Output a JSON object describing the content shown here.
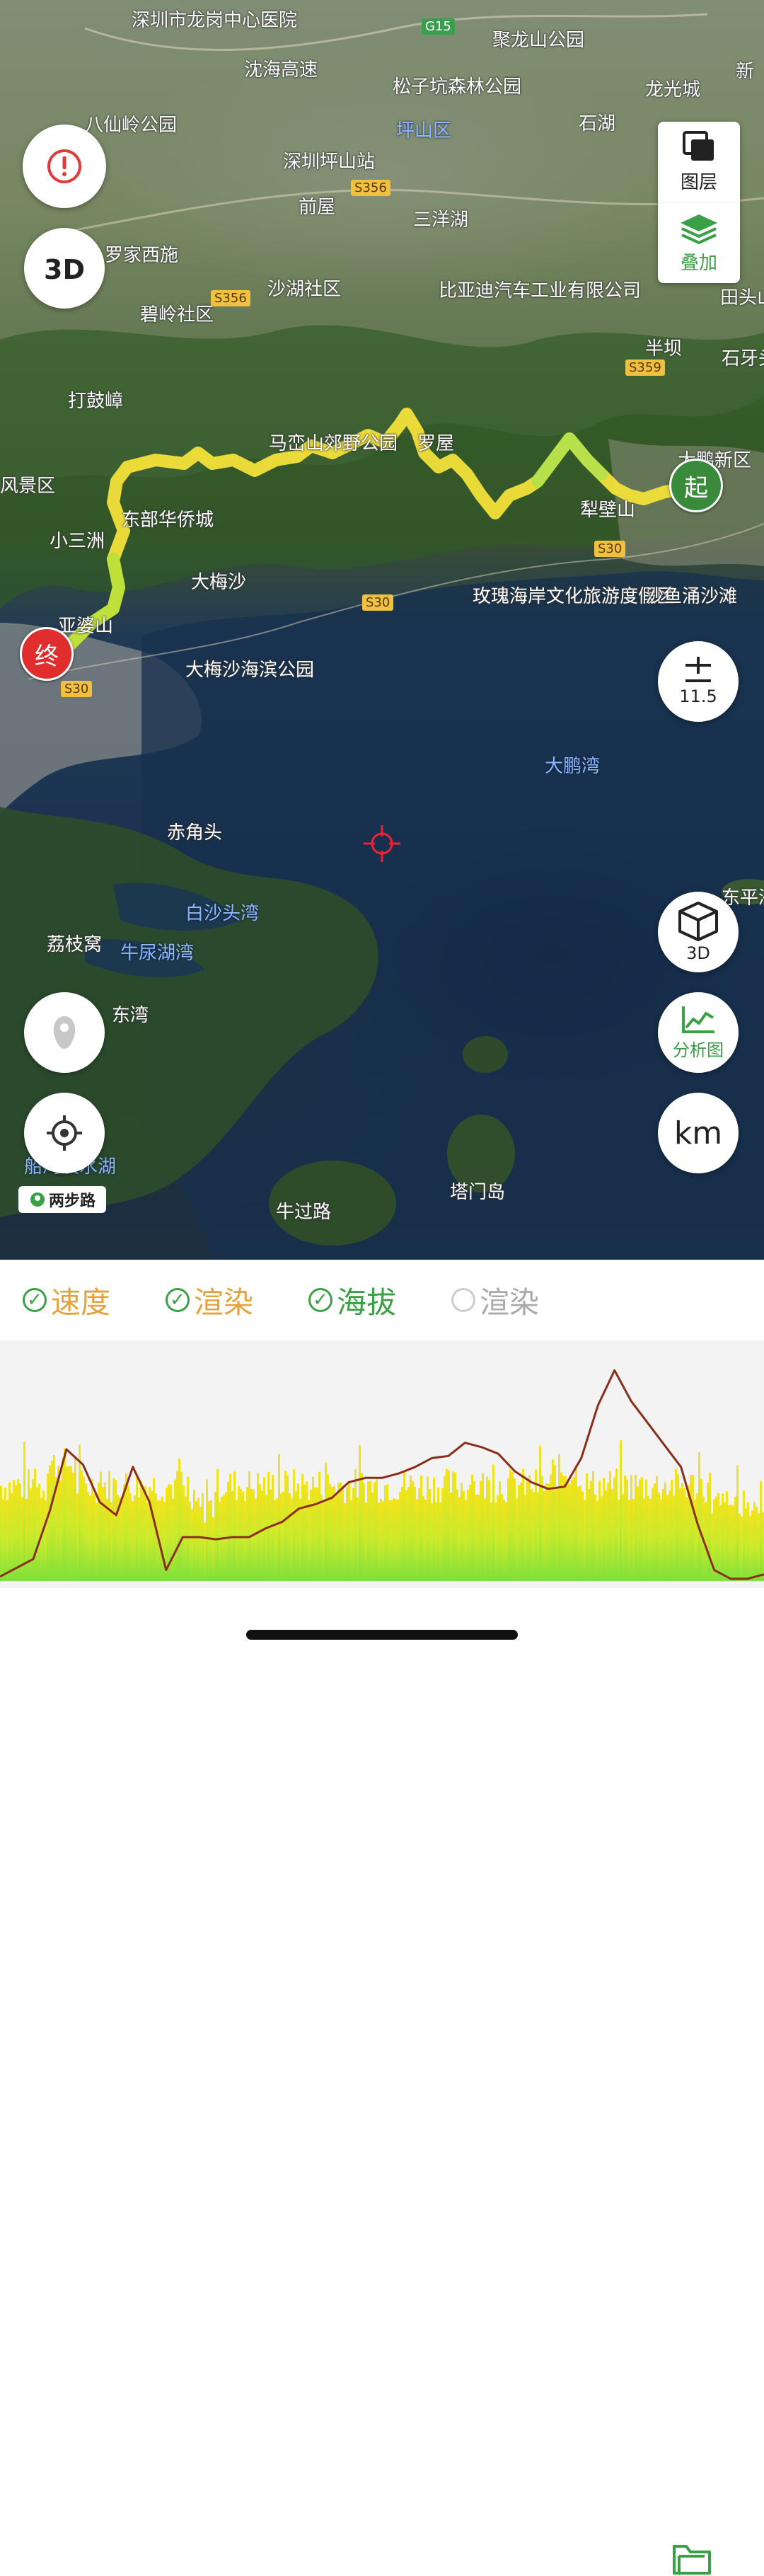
{
  "map": {
    "labels": [
      {
        "text": "深圳市龙岗中心医院",
        "x": 186,
        "y": 8,
        "cls": ""
      },
      {
        "text": "沈海高速",
        "x": 345,
        "y": 78,
        "cls": ""
      },
      {
        "text": "聚龙山公园",
        "x": 696,
        "y": 36,
        "cls": ""
      },
      {
        "text": "松子坑森林公园",
        "x": 555,
        "y": 102,
        "cls": ""
      },
      {
        "text": "龙光城",
        "x": 912,
        "y": 106,
        "cls": ""
      },
      {
        "text": "新",
        "x": 1040,
        "y": 80,
        "cls": ""
      },
      {
        "text": "八仙岭公园",
        "x": 120,
        "y": 156,
        "cls": ""
      },
      {
        "text": "坪山区",
        "x": 560,
        "y": 164,
        "cls": "water"
      },
      {
        "text": "石湖",
        "x": 818,
        "y": 154,
        "cls": ""
      },
      {
        "text": "深圳坪山站",
        "x": 400,
        "y": 208,
        "cls": ""
      },
      {
        "text": "前屋",
        "x": 422,
        "y": 272,
        "cls": ""
      },
      {
        "text": "三洋湖",
        "x": 584,
        "y": 290,
        "cls": ""
      },
      {
        "text": "罗家西施",
        "x": 148,
        "y": 340,
        "cls": ""
      },
      {
        "text": "沙湖社区",
        "x": 378,
        "y": 388,
        "cls": ""
      },
      {
        "text": "比亚迪汽车工业有限公司",
        "x": 620,
        "y": 390,
        "cls": ""
      },
      {
        "text": "碧岭社区",
        "x": 198,
        "y": 424,
        "cls": ""
      },
      {
        "text": "田头山",
        "x": 1018,
        "y": 400,
        "cls": ""
      },
      {
        "text": "半坝",
        "x": 912,
        "y": 472,
        "cls": ""
      },
      {
        "text": "石牙头",
        "x": 1020,
        "y": 486,
        "cls": ""
      },
      {
        "text": "打鼓嶂",
        "x": 96,
        "y": 546,
        "cls": ""
      },
      {
        "text": "马峦山郊野公园",
        "x": 380,
        "y": 606,
        "cls": ""
      },
      {
        "text": "罗屋",
        "x": 590,
        "y": 606,
        "cls": ""
      },
      {
        "text": "大鹏新区",
        "x": 958,
        "y": 630,
        "cls": ""
      },
      {
        "text": "风景区",
        "x": 0,
        "y": 666,
        "cls": ""
      },
      {
        "text": "东部华侨城",
        "x": 172,
        "y": 714,
        "cls": ""
      },
      {
        "text": "犁壁山",
        "x": 820,
        "y": 700,
        "cls": ""
      },
      {
        "text": "小三洲",
        "x": 70,
        "y": 744,
        "cls": ""
      },
      {
        "text": "大梅沙",
        "x": 270,
        "y": 802,
        "cls": ""
      },
      {
        "text": "玫瑰海岸文化旅游度假区",
        "x": 668,
        "y": 822,
        "cls": ""
      },
      {
        "text": "沙鱼涌沙滩",
        "x": 912,
        "y": 822,
        "cls": ""
      },
      {
        "text": "亚婆山",
        "x": 82,
        "y": 864,
        "cls": ""
      },
      {
        "text": "大梅沙海滨公园",
        "x": 262,
        "y": 926,
        "cls": ""
      },
      {
        "text": "大鹏湾",
        "x": 770,
        "y": 1062,
        "cls": "water"
      },
      {
        "text": "赤角头",
        "x": 236,
        "y": 1156,
        "cls": ""
      },
      {
        "text": "东平洲",
        "x": 1020,
        "y": 1248,
        "cls": ""
      },
      {
        "text": "白沙头湾",
        "x": 262,
        "y": 1270,
        "cls": "water"
      },
      {
        "text": "荔枝窝",
        "x": 66,
        "y": 1314,
        "cls": ""
      },
      {
        "text": "牛尿湖湾",
        "x": 170,
        "y": 1326,
        "cls": "water"
      },
      {
        "text": "东湾",
        "x": 158,
        "y": 1414,
        "cls": ""
      },
      {
        "text": "船湾淡水湖",
        "x": 34,
        "y": 1628,
        "cls": "water"
      },
      {
        "text": "塔门岛",
        "x": 636,
        "y": 1664,
        "cls": ""
      },
      {
        "text": "牛过路",
        "x": 390,
        "y": 1692,
        "cls": ""
      }
    ],
    "road_tags": [
      {
        "text": "G15",
        "x": 596,
        "y": 26,
        "cls": "green"
      },
      {
        "text": "S356",
        "x": 496,
        "y": 254,
        "cls": ""
      },
      {
        "text": "S356",
        "x": 298,
        "y": 410,
        "cls": ""
      },
      {
        "text": "S359",
        "x": 884,
        "y": 508,
        "cls": ""
      },
      {
        "text": "S30",
        "x": 840,
        "y": 764,
        "cls": ""
      },
      {
        "text": "S30",
        "x": 512,
        "y": 840,
        "cls": ""
      },
      {
        "text": "S30",
        "x": 86,
        "y": 962,
        "cls": ""
      }
    ],
    "start_label": "起",
    "end_label": "终",
    "brand": "两步路"
  },
  "controls": {
    "layers_label": "图层",
    "overlay_label": "叠加",
    "zoom_level": "11.5",
    "btn_3d_label": "3D",
    "analysis_label": "分析图",
    "unit_label": "km"
  },
  "toggles": [
    {
      "label": "速度",
      "checked": true,
      "color": "#e6a23c"
    },
    {
      "label": "渲染",
      "checked": true,
      "color": "#e6a23c"
    },
    {
      "label": "海拔",
      "checked": true,
      "color": "#3aa046"
    },
    {
      "label": "渲染",
      "checked": false,
      "color": "#aaaaaa"
    }
  ],
  "chart_data": {
    "type": "line",
    "series": [
      {
        "values": [
          0.02,
          0.06,
          0.1,
          0.32,
          0.6,
          0.53,
          0.36,
          0.3,
          0.52,
          0.36,
          0.05,
          0.2,
          0.2,
          0.19,
          0.2,
          0.2,
          0.24,
          0.27,
          0.33,
          0.35,
          0.38,
          0.45,
          0.47,
          0.47,
          0.49,
          0.52,
          0.56,
          0.57,
          0.63,
          0.61,
          0.58,
          0.5,
          0.45,
          0.42,
          0.43,
          0.56,
          0.8,
          0.96,
          0.82,
          0.72,
          0.62,
          0.52,
          0.26,
          0.05,
          0.01,
          0.01,
          0.03
        ]
      }
    ],
    "secondary_fill": "speed shading (yellow→green)"
  }
}
